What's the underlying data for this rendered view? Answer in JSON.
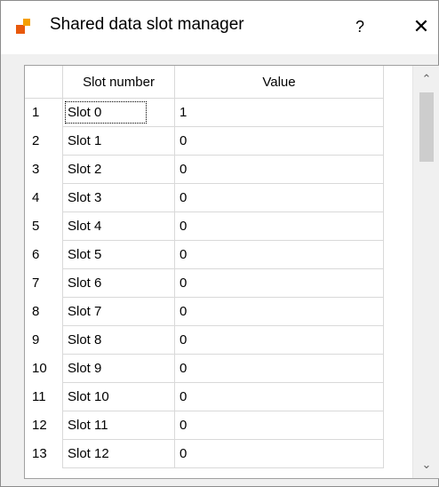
{
  "window": {
    "title": "Shared data slot manager",
    "help_label": "?",
    "close_label": "✕"
  },
  "table": {
    "columns": [
      "Slot number",
      "Value"
    ],
    "rows": [
      {
        "index": "1",
        "slot": "Slot 0",
        "value": "1"
      },
      {
        "index": "2",
        "slot": "Slot 1",
        "value": "0"
      },
      {
        "index": "3",
        "slot": "Slot 2",
        "value": "0"
      },
      {
        "index": "4",
        "slot": "Slot 3",
        "value": "0"
      },
      {
        "index": "5",
        "slot": "Slot 4",
        "value": "0"
      },
      {
        "index": "6",
        "slot": "Slot 5",
        "value": "0"
      },
      {
        "index": "7",
        "slot": "Slot 6",
        "value": "0"
      },
      {
        "index": "8",
        "slot": "Slot 7",
        "value": "0"
      },
      {
        "index": "9",
        "slot": "Slot 8",
        "value": "0"
      },
      {
        "index": "10",
        "slot": "Slot 9",
        "value": "0"
      },
      {
        "index": "11",
        "slot": "Slot 10",
        "value": "0"
      },
      {
        "index": "12",
        "slot": "Slot 11",
        "value": "0"
      },
      {
        "index": "13",
        "slot": "Slot 12",
        "value": "0"
      }
    ]
  },
  "scrollbar": {
    "up_arrow": "⌃",
    "down_arrow": "⌄"
  }
}
